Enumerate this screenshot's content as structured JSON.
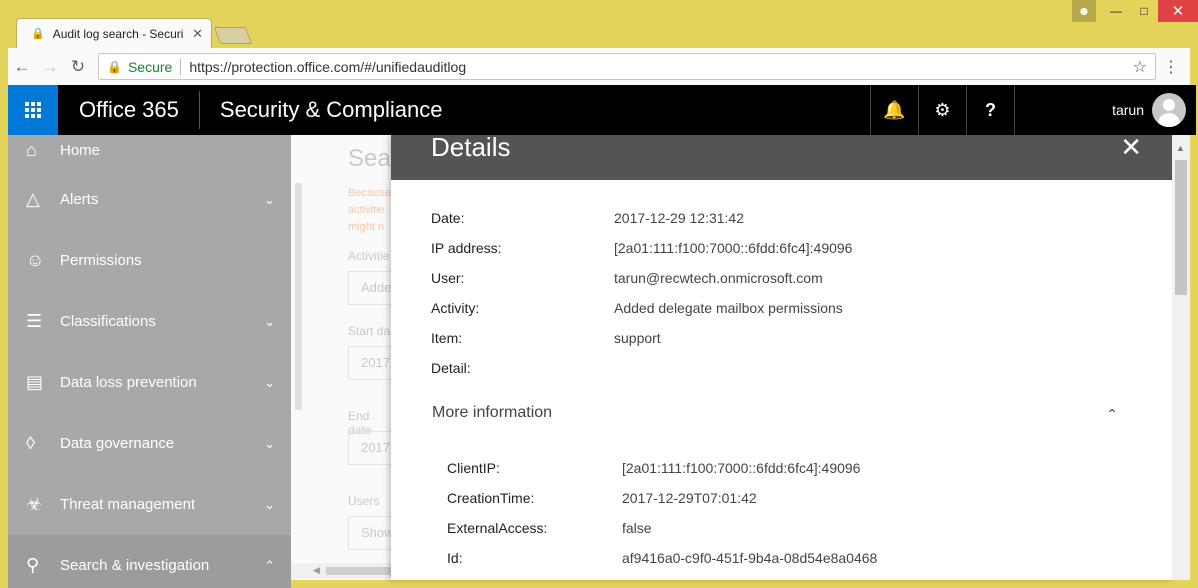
{
  "browser": {
    "tab_title": "Audit log search - Securi",
    "secure_label": "Secure",
    "url": "https://protection.office.com/#/unifiedauditlog"
  },
  "header": {
    "brand": "Office 365",
    "product": "Security & Compliance",
    "username": "tarun"
  },
  "sidebar": {
    "items": [
      {
        "label": "Home",
        "icon": "home-icon",
        "expandable": false
      },
      {
        "label": "Alerts",
        "icon": "alert-icon",
        "expandable": true
      },
      {
        "label": "Permissions",
        "icon": "people-icon",
        "expandable": false
      },
      {
        "label": "Classifications",
        "icon": "list-icon",
        "expandable": true
      },
      {
        "label": "Data loss prevention",
        "icon": "document-lock-icon",
        "expandable": true
      },
      {
        "label": "Data governance",
        "icon": "lock-icon",
        "expandable": true
      },
      {
        "label": "Threat management",
        "icon": "biohazard-icon",
        "expandable": true
      },
      {
        "label": "Search & investigation",
        "icon": "search-icon",
        "expandable": true
      }
    ]
  },
  "background_page": {
    "title": "Sea",
    "warning": [
      "Because",
      "activitie",
      "might n"
    ],
    "activities_label": "Activitie",
    "activities_value": "Adde",
    "start_label": "Start da",
    "start_value": "2017",
    "end_label": "End date",
    "end_value": "2017",
    "users_label": "Users",
    "users_value": "Show"
  },
  "details": {
    "title": "Details",
    "fields": [
      {
        "key": "Date:",
        "value": "2017-12-29 12:31:42"
      },
      {
        "key": "IP address:",
        "value": "[2a01:111:f100:7000::6fdd:6fc4]:49096"
      },
      {
        "key": "User:",
        "value": "tarun@recwtech.onmicrosoft.com"
      },
      {
        "key": "Activity:",
        "value": "Added delegate mailbox permissions"
      },
      {
        "key": "Item:",
        "value": "support"
      },
      {
        "key": "Detail:",
        "value": ""
      }
    ],
    "more_info_label": "More information",
    "more_fields": [
      {
        "key": "ClientIP:",
        "value": "[2a01:111:f100:7000::6fdd:6fc4]:49096"
      },
      {
        "key": "CreationTime:",
        "value": "2017-12-29T07:01:42"
      },
      {
        "key": "ExternalAccess:",
        "value": "false"
      },
      {
        "key": "Id:",
        "value": "af9416a0-c9f0-451f-9b4a-08d54e8a0468"
      }
    ]
  }
}
